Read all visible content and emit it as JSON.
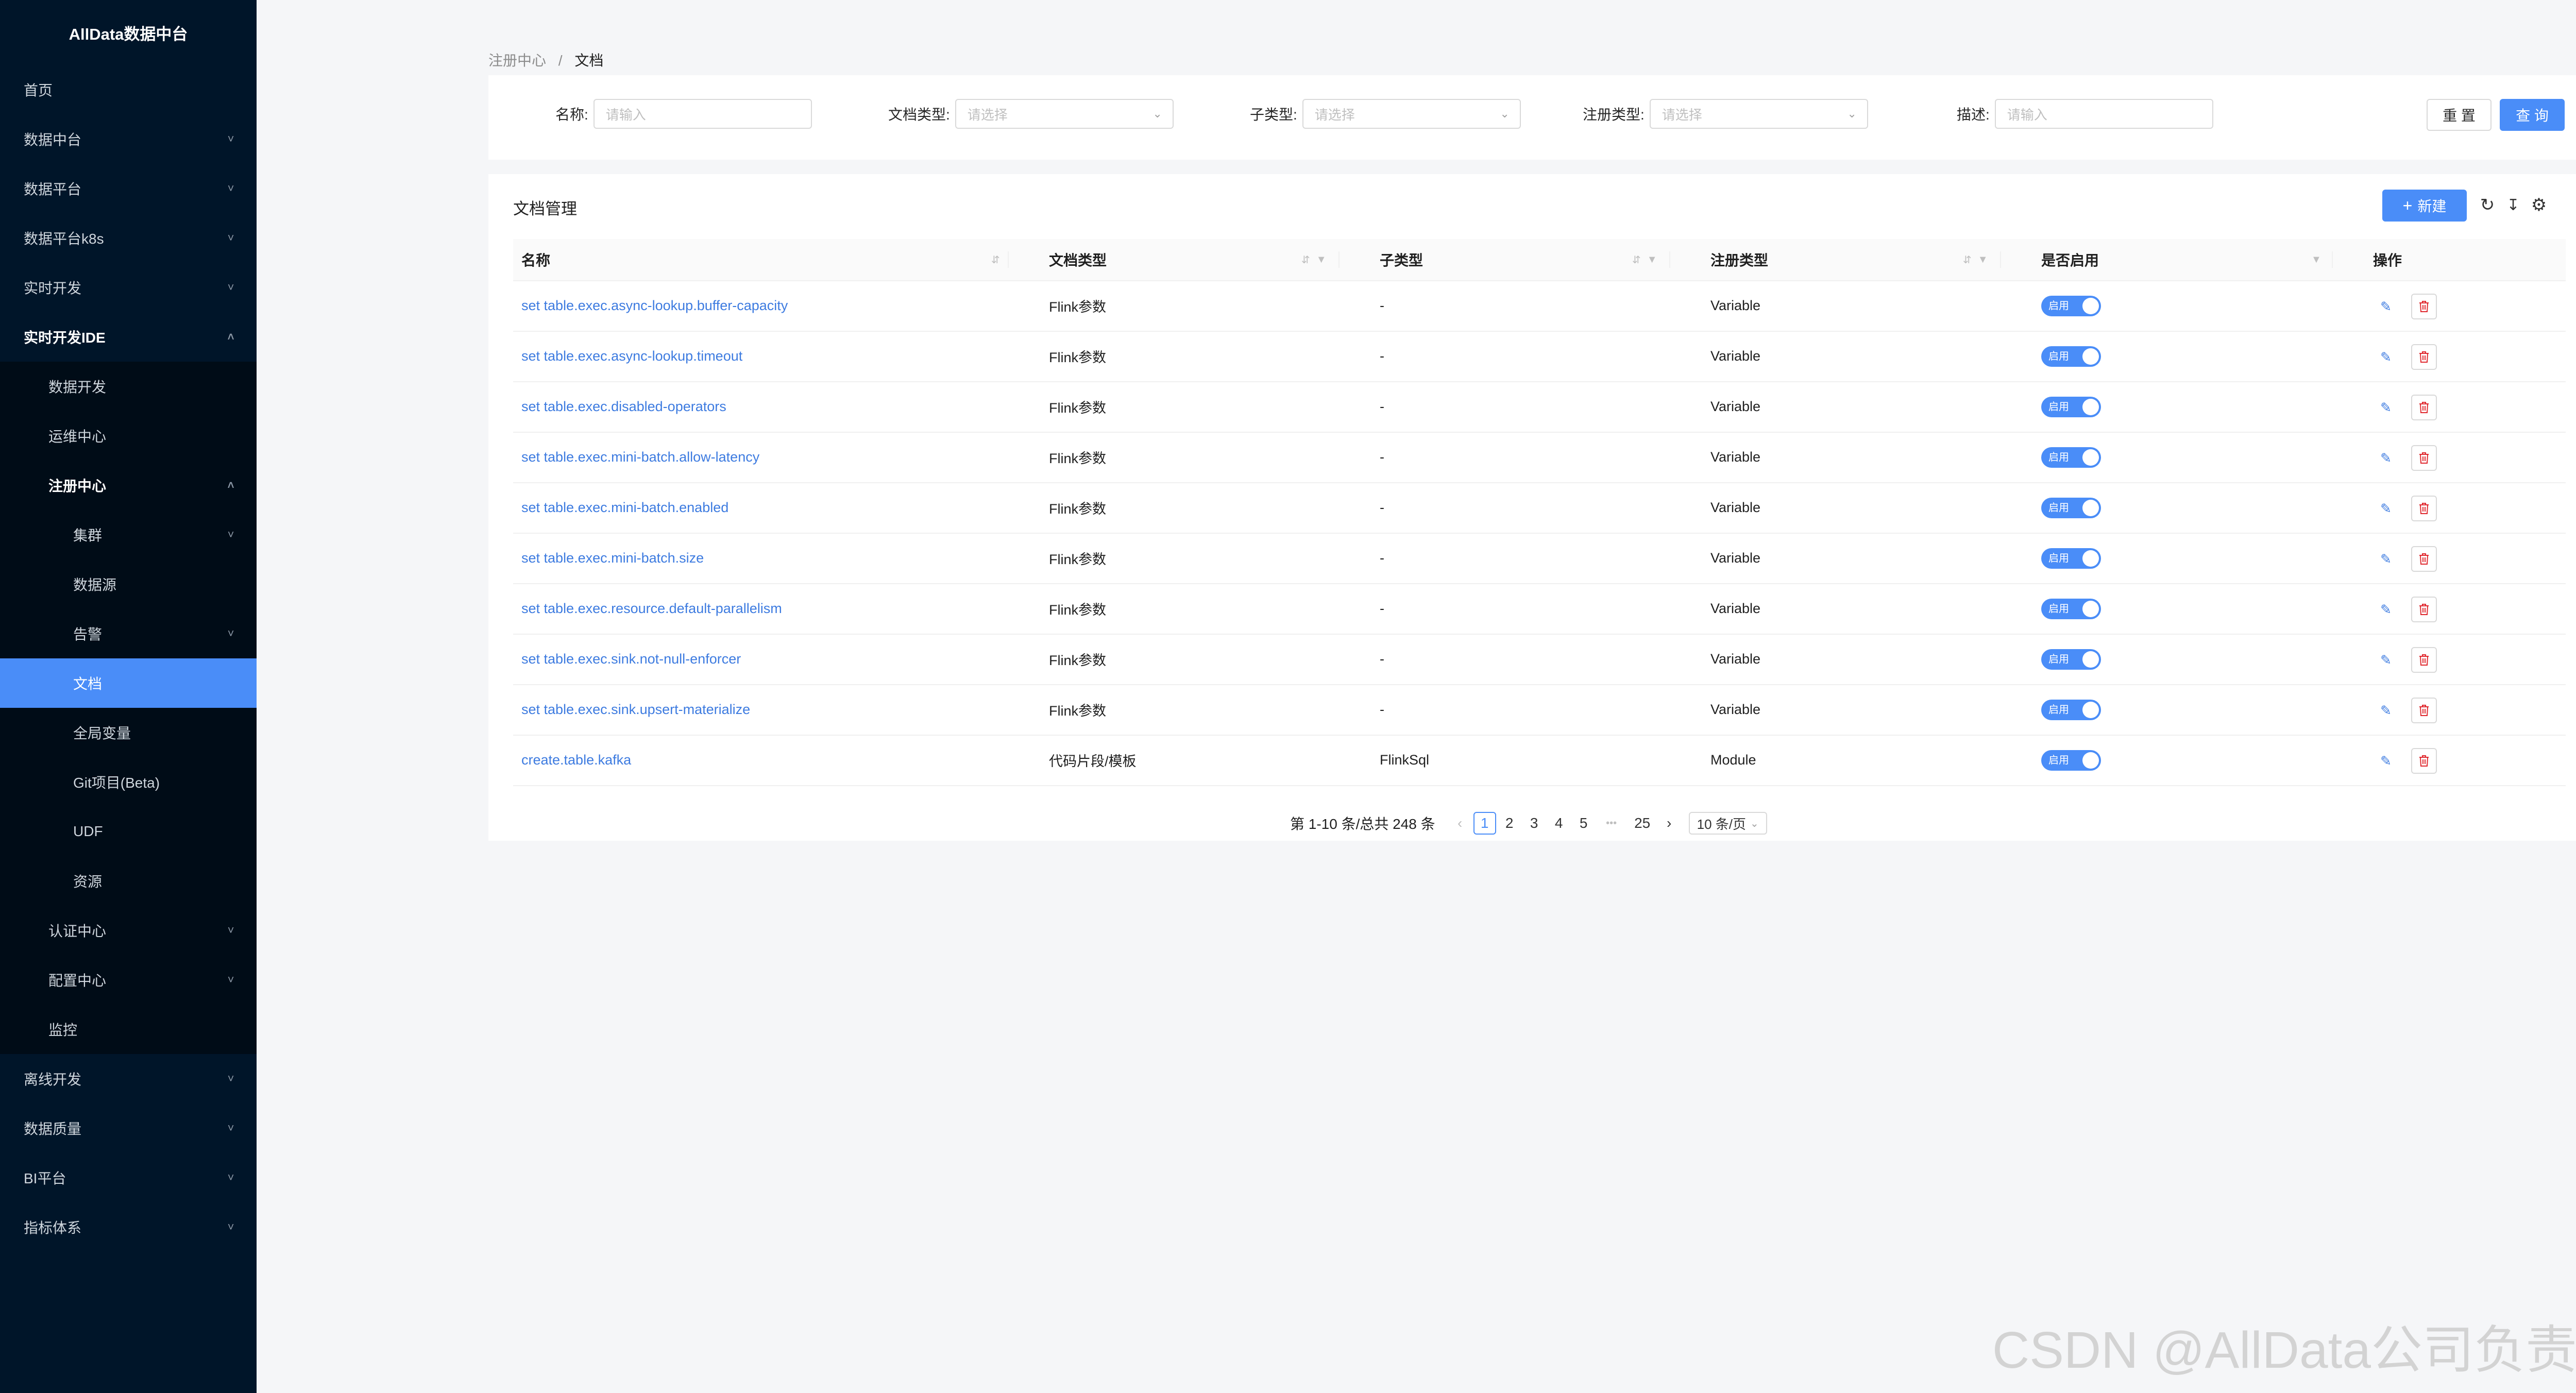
{
  "sidebar": {
    "logo": "AllData数据中台",
    "items": [
      {
        "label": "首页",
        "level": 1,
        "arrow": ""
      },
      {
        "label": "数据中台",
        "level": 1,
        "arrow": "down"
      },
      {
        "label": "数据平台",
        "level": 1,
        "arrow": "down"
      },
      {
        "label": "数据平台k8s",
        "level": 1,
        "arrow": "down"
      },
      {
        "label": "实时开发",
        "level": 1,
        "arrow": "down"
      },
      {
        "label": "实时开发IDE",
        "level": 1,
        "arrow": "up",
        "bold": true
      },
      {
        "label": "数据开发",
        "level": 2,
        "arrow": ""
      },
      {
        "label": "运维中心",
        "level": 2,
        "arrow": ""
      },
      {
        "label": "注册中心",
        "level": 2,
        "arrow": "up",
        "bold": true
      },
      {
        "label": "集群",
        "level": 3,
        "arrow": "down"
      },
      {
        "label": "数据源",
        "level": 3,
        "arrow": ""
      },
      {
        "label": "告警",
        "level": 3,
        "arrow": "down"
      },
      {
        "label": "文档",
        "level": 3,
        "arrow": "",
        "active": true
      },
      {
        "label": "全局变量",
        "level": 3,
        "arrow": ""
      },
      {
        "label": "Git项目(Beta)",
        "level": 3,
        "arrow": ""
      },
      {
        "label": "UDF",
        "level": 3,
        "arrow": ""
      },
      {
        "label": "资源",
        "level": 3,
        "arrow": ""
      },
      {
        "label": "认证中心",
        "level": 2,
        "arrow": "down"
      },
      {
        "label": "配置中心",
        "level": 2,
        "arrow": "down"
      },
      {
        "label": "监控",
        "level": 2,
        "arrow": ""
      },
      {
        "label": "离线开发",
        "level": 1,
        "arrow": "down"
      },
      {
        "label": "数据质量",
        "level": 1,
        "arrow": "down"
      },
      {
        "label": "BI平台",
        "level": 1,
        "arrow": "down"
      },
      {
        "label": "指标体系",
        "level": 1,
        "arrow": "down"
      }
    ]
  },
  "breadcrumb": {
    "parent": "注册中心",
    "separator": "/",
    "current": "文档"
  },
  "search": {
    "name_label": "名称:",
    "name_placeholder": "请输入",
    "doc_type_label": "文档类型:",
    "doc_type_placeholder": "请选择",
    "sub_type_label": "子类型:",
    "sub_type_placeholder": "请选择",
    "reg_type_label": "注册类型:",
    "reg_type_placeholder": "请选择",
    "desc_label": "描述:",
    "desc_placeholder": "请输入",
    "reset_label": "重 置",
    "query_label": "查 询"
  },
  "table": {
    "title": "文档管理",
    "new_label": "新建",
    "columns": {
      "name": "名称",
      "doc_type": "文档类型",
      "sub_type": "子类型",
      "reg_type": "注册类型",
      "enabled": "是否启用",
      "actions": "操作"
    },
    "switch_label": "启用",
    "rows": [
      {
        "name": "set table.exec.async-lookup.buffer-capacity",
        "doc_type": "Flink参数",
        "sub_type": "-",
        "reg_type": "Variable",
        "enabled": true
      },
      {
        "name": "set table.exec.async-lookup.timeout",
        "doc_type": "Flink参数",
        "sub_type": "-",
        "reg_type": "Variable",
        "enabled": true
      },
      {
        "name": "set table.exec.disabled-operators",
        "doc_type": "Flink参数",
        "sub_type": "-",
        "reg_type": "Variable",
        "enabled": true
      },
      {
        "name": "set table.exec.mini-batch.allow-latency",
        "doc_type": "Flink参数",
        "sub_type": "-",
        "reg_type": "Variable",
        "enabled": true
      },
      {
        "name": "set table.exec.mini-batch.enabled",
        "doc_type": "Flink参数",
        "sub_type": "-",
        "reg_type": "Variable",
        "enabled": true
      },
      {
        "name": "set table.exec.mini-batch.size",
        "doc_type": "Flink参数",
        "sub_type": "-",
        "reg_type": "Variable",
        "enabled": true
      },
      {
        "name": "set table.exec.resource.default-parallelism",
        "doc_type": "Flink参数",
        "sub_type": "-",
        "reg_type": "Variable",
        "enabled": true
      },
      {
        "name": "set table.exec.sink.not-null-enforcer",
        "doc_type": "Flink参数",
        "sub_type": "-",
        "reg_type": "Variable",
        "enabled": true
      },
      {
        "name": "set table.exec.sink.upsert-materialize",
        "doc_type": "Flink参数",
        "sub_type": "-",
        "reg_type": "Variable",
        "enabled": true
      },
      {
        "name": "create.table.kafka",
        "doc_type": "代码片段/模板",
        "sub_type": "FlinkSql",
        "reg_type": "Module",
        "enabled": true
      }
    ]
  },
  "pagination": {
    "summary": "第 1-10 条/总共 248 条",
    "pages": [
      "1",
      "2",
      "3",
      "4",
      "5"
    ],
    "ellipsis": "•••",
    "last_page": "25",
    "current": "1",
    "page_size": "10 条/页"
  },
  "watermark": "CSDN @AllData公司负责人",
  "colors": {
    "sidebar_bg": "#001529",
    "submenu_bg": "#000c17",
    "accent": "#4a8df8",
    "link": "#3d7be0",
    "danger": "#e0282e"
  }
}
